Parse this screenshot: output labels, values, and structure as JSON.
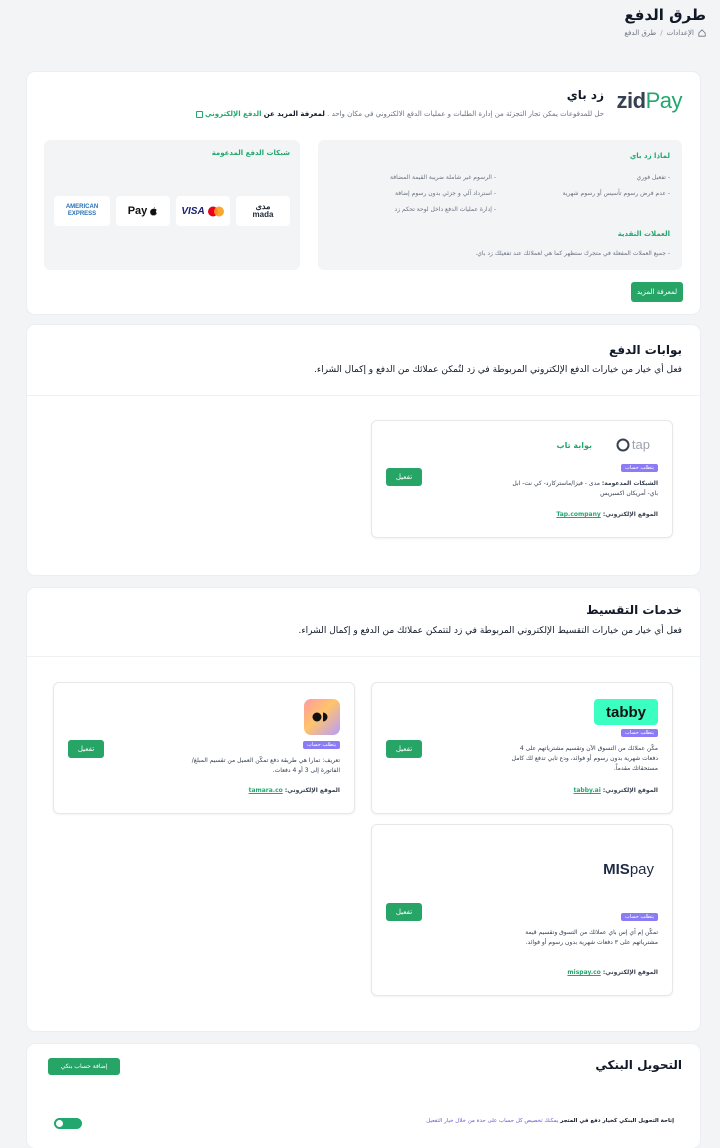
{
  "page": {
    "title": "طرق الدفع",
    "breadcrumb": {
      "parent": "الإعدادات",
      "separator": "/",
      "current": "طرق الدفع"
    }
  },
  "zidpay": {
    "logo_part1": "zid",
    "logo_part2": "Pay",
    "title": "زد باي",
    "description": "حل للمدفوعات يمكن تجار التجزئة من إدارة الطلبات و عمليات الدفع الالكتروني في مكان واحد .",
    "learn_prefix": "لمعرفة المزيد عن",
    "learn_link": "الدفع الإلكتروني",
    "why_title": "لماذا زد باي",
    "why_items": [
      "- تفعيل فوري",
      "- عدم فرض رسوم تأسيس أو رسوم شهرية",
      "- الرسوم غير شاملة ضريبة القيمة المضافة",
      "- استرداد آلي و جزئي بدون رسوم إضافة",
      "- إدارة عمليات الدفع داخل لوحة تحكم زد"
    ],
    "currencies_title": "العملات النقدية",
    "currencies_text": "- جميع العملات المفعلة في متجرك ستظهر كما هي لعملائك عند تفعيلك زد باي.",
    "networks_title": "شبكات الدفع المدعومة",
    "networks": [
      "mada",
      "VISA",
      "Pay",
      "AMERICAN EXPRESS"
    ],
    "mada_ar": "مدى",
    "learn_button": "لمعرفة المزيد"
  },
  "gateways": {
    "title": "بوابات الدفع",
    "description": "فعل أي خيار من خيارات الدفع الإلكتروني المربوطة في زد لتُمكن عملائك من الدفع و إكمال الشراء.",
    "tap": {
      "logo": "tap",
      "name": "بوابة تاب",
      "badge": "يتطلب حساب",
      "networks_label": "الشبكات المدعومة:",
      "networks_text": "مدى - فيزا/ماستركارد- كي نت- ابل باي- أمريكان اكسبريس",
      "site_label": "الموقع الإلكتروني:",
      "site_link": "Tap.company",
      "activate": "تفعيل"
    }
  },
  "installments": {
    "title": "خدمات التقسيط",
    "description": "فعل أي خيار من خيارات التقسيط الإلكتروني المربوطة في زد لتتمكن عملائك من الدفع و إكمال الشراء.",
    "tabby": {
      "logo": "tabby",
      "badge": "يتطلب حساب",
      "text": "مكّن عملائك من التسوق الآن وتقسيم مشترياتهم على 4 دفعات شهرية بدون رسوم أو فوائد، ودع تابي تدفع لك كامل مستحقاتك مقدماً.",
      "site_label": "الموقع الإلكتروني:",
      "site_link": "tabby.ai",
      "activate": "تفعيل"
    },
    "tamara": {
      "badge": "يتطلب حساب",
      "text": "تعريف: تمارا هي طريقة دفع تمكّن العميل من تقسيم المبلغ/الفاتورة إلى 3 أو 4 دفعات.",
      "site_label": "الموقع الإلكتروني:",
      "site_link": "tamara.co",
      "activate": "تفعيل"
    },
    "mispay": {
      "logo_part1": "MIS",
      "logo_part2": "pay",
      "badge": "يتطلب حساب",
      "text": "تمكّن إم آي إس باي عملائك من التسوق وتقسيم قيمة مشترياتهم على ٣ دفعات شهرية بدون رسوم أو فوائد.",
      "site_label": "الموقع الإلكتروني:",
      "site_link": "mispay.co",
      "activate": "تفعيل"
    }
  },
  "bank": {
    "title": "التحويل البنكي",
    "add_button": "إضافة حساب بنكي",
    "toggle_label": "إتاحة التحويل البنكي كخيار دفع في المتجر",
    "toggle_hint": "يمكنك تخصيص كل حساب على حدة من خلال خيار التفعيل",
    "toggle_on": true
  },
  "colors": {
    "accent": "#27a567",
    "badge": "#8b7cf6",
    "background": "#f3f4f6"
  }
}
